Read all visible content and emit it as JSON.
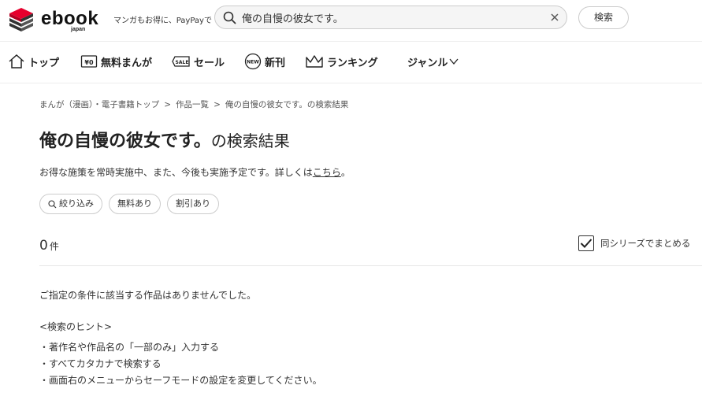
{
  "header": {
    "logo_text": "ebook",
    "logo_sub": "japan",
    "tagline": "マンガもお得に、PayPayで",
    "search_value": "俺の自慢の彼女です。",
    "search_button": "検索"
  },
  "nav": {
    "items": [
      {
        "label": "トップ",
        "icon": "home-icon"
      },
      {
        "label": "無料まんが",
        "icon": "free-yen-icon"
      },
      {
        "label": "セール",
        "icon": "sale-tag-icon"
      },
      {
        "label": "新刊",
        "icon": "new-badge-icon"
      },
      {
        "label": "ランキング",
        "icon": "crown-icon"
      },
      {
        "label": "ジャンル",
        "icon": "chevron-down-icon"
      }
    ]
  },
  "breadcrumb": [
    "まんが（漫画）・電子書籍トップ",
    "作品一覧",
    "俺の自慢の彼女です。の検索結果"
  ],
  "breadcrumb_sep": ">",
  "page": {
    "title_query": "俺の自慢の彼女です。",
    "title_suffix": "の検索結果",
    "notice_text": "お得な施策を常時実施中、また、今後も実施予定です。詳しくは",
    "notice_link": "こちら",
    "notice_end": "。",
    "chips": [
      "絞り込み",
      "無料あり",
      "割引あり"
    ],
    "count": "0",
    "count_unit": "件",
    "series_label": "同シリーズでまとめる",
    "series_checked": true,
    "no_results": "ご指定の条件に該当する作品はありませんでした。",
    "hint_title": "<検索のヒント>",
    "hints": [
      "・著作名や作品名の「一部のみ」入力する",
      "・すべてカタカナで検索する",
      "・画面右のメニューからセーフモードの設定を変更してください。"
    ]
  },
  "colors": {
    "logo_red": "#e6002d",
    "text": "#333333",
    "border": "#cccccc"
  }
}
